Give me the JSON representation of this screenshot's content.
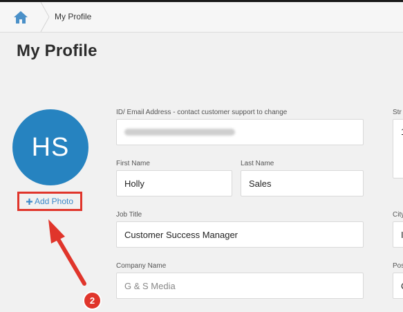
{
  "breadcrumb": {
    "home_icon": "home-icon",
    "current": "My Profile"
  },
  "page": {
    "title": "My Profile"
  },
  "avatar": {
    "initials": "HS",
    "color": "#2683c0"
  },
  "add_photo": {
    "label": "Add Photo",
    "icon": "plus-icon"
  },
  "annotation": {
    "step": "2",
    "color": "#e0352b"
  },
  "form": {
    "email_label": "ID/ Email Address - contact customer support to change",
    "first_name_label": "First Name",
    "first_name_value": "Holly",
    "last_name_label": "Last Name",
    "last_name_value": "Sales",
    "job_title_label": "Job Title",
    "job_title_value": "Customer Success Manager",
    "company_label": "Company Name",
    "company_value": "G & S Media"
  },
  "right_column": {
    "street_label": "Str",
    "street_value": "1",
    "city_label": "City",
    "city_value": "I",
    "postal_label": "Pos",
    "postal_value": "C"
  }
}
